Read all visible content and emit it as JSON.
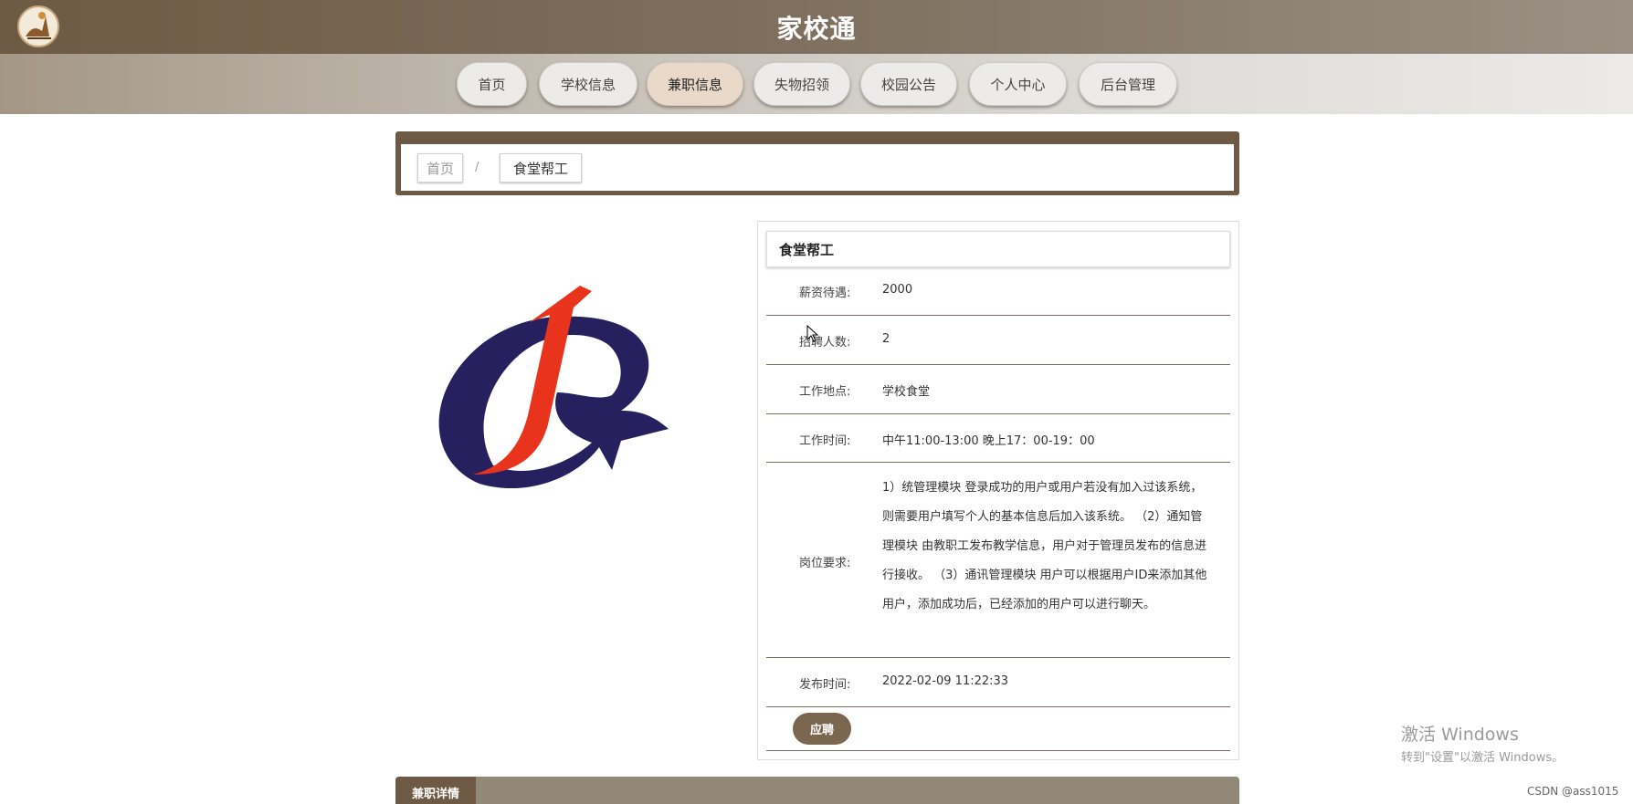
{
  "header": {
    "title": "家校通",
    "logo_icon": "app-logo-icon"
  },
  "nav": {
    "items": [
      {
        "label": "首页"
      },
      {
        "label": "学校信息"
      },
      {
        "label": "兼职信息",
        "active": true
      },
      {
        "label": "失物招领"
      },
      {
        "label": "校园公告"
      },
      {
        "label": "个人中心"
      },
      {
        "label": "后台管理"
      }
    ]
  },
  "breadcrumb": {
    "home": "首页",
    "separator": "/",
    "current": "食堂帮工"
  },
  "job": {
    "title": "食堂帮工",
    "fields": [
      {
        "label": "薪资待遇:",
        "value": "2000"
      },
      {
        "label": "招聘人数:",
        "value": "2"
      },
      {
        "label": "工作地点:",
        "value": "学校食堂"
      },
      {
        "label": "工作时间:",
        "value": "中午11:00-13:00 晚上17：00-19：00"
      }
    ],
    "requirement_label": "岗位要求:",
    "requirement_value": "1）统管理模块 登录成功的用户或用户若没有加入过该系统，则需要用户填写个人的基本信息后加入该系统。 （2）通知管理模块 由教职工发布教学信息，用户对于管理员发布的信息进行接收。 （3）通讯管理模块 用户可以根据用户ID来添加其他用户，添加成功后，已经添加的用户可以进行聊天。",
    "published_label": "发布时间:",
    "published_value": "2022-02-09 11:22:33",
    "apply_label": "应聘"
  },
  "detail_tab": {
    "label": "兼职详情"
  },
  "watermark": {
    "line1": "激活 Windows",
    "line2": "转到\"设置\"以激活 Windows。"
  },
  "csdn": "CSDN @ass1015",
  "colors": {
    "brand_brown": "#6e5a44",
    "active_nav": "#ead9c8",
    "logo_navy": "#26205f",
    "logo_red": "#e8341c"
  }
}
